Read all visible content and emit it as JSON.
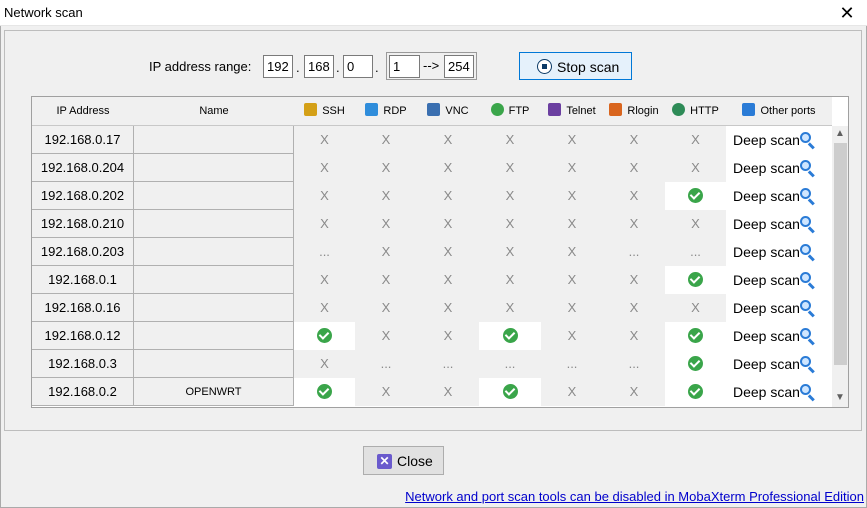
{
  "window": {
    "title": "Network scan",
    "close_glyph": "✕"
  },
  "ip_range": {
    "label": "IP address range:",
    "octet1": "192",
    "octet2": "168",
    "octet3": "0",
    "separator": ".",
    "start": "1",
    "arrow": "-->",
    "end": "254"
  },
  "buttons": {
    "stop_scan": "Stop scan",
    "close": "Close"
  },
  "columns": {
    "ip": "IP Address",
    "name": "Name",
    "ports": [
      {
        "label": "SSH",
        "icon": "ssh-icon",
        "color": "#d4a017"
      },
      {
        "label": "RDP",
        "icon": "rdp-icon",
        "color": "#2f8ddb"
      },
      {
        "label": "VNC",
        "icon": "vnc-icon",
        "color": "#3a6fb0"
      },
      {
        "label": "FTP",
        "icon": "ftp-icon",
        "color": "#3aa54a"
      },
      {
        "label": "Telnet",
        "icon": "telnet-icon",
        "color": "#6b3fa0"
      },
      {
        "label": "Rlogin",
        "icon": "rlogin-icon",
        "color": "#d9651e"
      },
      {
        "label": "HTTP",
        "icon": "http-icon",
        "color": "#2e8b57"
      },
      {
        "label": "Other ports",
        "icon": "wifi-icon",
        "color": "#2a7bd6"
      }
    ]
  },
  "symbols": {
    "no": "X",
    "pending": "...",
    "yes": "✓"
  },
  "deep_scan_label": "Deep scan",
  "rows": [
    {
      "ip": "192.168.0.17",
      "name": "",
      "ports": [
        "X",
        "X",
        "X",
        "X",
        "X",
        "X",
        "X"
      ]
    },
    {
      "ip": "192.168.0.204",
      "name": "",
      "ports": [
        "X",
        "X",
        "X",
        "X",
        "X",
        "X",
        "X"
      ]
    },
    {
      "ip": "192.168.0.202",
      "name": "",
      "ports": [
        "X",
        "X",
        "X",
        "X",
        "X",
        "X",
        "ok"
      ]
    },
    {
      "ip": "192.168.0.210",
      "name": "",
      "ports": [
        "X",
        "X",
        "X",
        "X",
        "X",
        "X",
        "X"
      ]
    },
    {
      "ip": "192.168.0.203",
      "name": "",
      "ports": [
        "...",
        "X",
        "X",
        "X",
        "X",
        "...",
        "..."
      ]
    },
    {
      "ip": "192.168.0.1",
      "name": "",
      "ports": [
        "X",
        "X",
        "X",
        "X",
        "X",
        "X",
        "ok"
      ]
    },
    {
      "ip": "192.168.0.16",
      "name": "",
      "ports": [
        "X",
        "X",
        "X",
        "X",
        "X",
        "X",
        "X"
      ]
    },
    {
      "ip": "192.168.0.12",
      "name": "",
      "ports": [
        "ok",
        "X",
        "X",
        "ok",
        "X",
        "X",
        "ok"
      ]
    },
    {
      "ip": "192.168.0.3",
      "name": "",
      "ports": [
        "X",
        "...",
        "...",
        "...",
        "...",
        "...",
        "ok"
      ]
    },
    {
      "ip": "192.168.0.2",
      "name": "OPENWRT",
      "ports": [
        "ok",
        "X",
        "X",
        "ok",
        "X",
        "X",
        "ok"
      ]
    }
  ],
  "footer_link": "Network and port scan tools can be disabled in MobaXterm Professional Edition"
}
